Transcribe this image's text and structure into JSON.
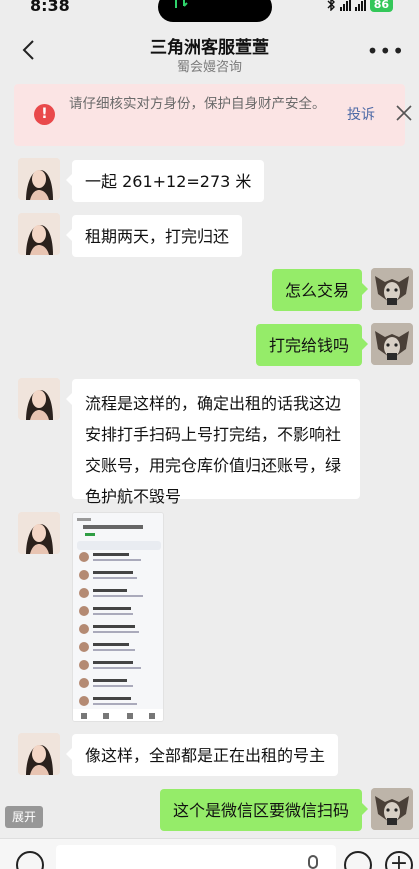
{
  "status_bar": {
    "time": "8:38",
    "battery": "86"
  },
  "nav": {
    "title": "三角洲客服萱萱",
    "subtitle": "蜀会嫚咨询"
  },
  "warning": {
    "text": "请仔细核实对方身份，保护自身财产安全。",
    "report_label": "投诉"
  },
  "messages": [
    {
      "side": "in",
      "text": "一起 261+12=273 米"
    },
    {
      "side": "in",
      "text": "租期两天，打完归还"
    },
    {
      "side": "out",
      "text": "怎么交易"
    },
    {
      "side": "out",
      "text": "打完给钱吗"
    },
    {
      "side": "in",
      "text": "流程是这样的，确定出租的话我这边安排打手扫码上号打完结，不影响社交账号，用完仓库价值归还账号，绿色护航不毁号"
    },
    {
      "side": "in",
      "type": "image"
    },
    {
      "side": "in",
      "text": "像这样，全部都是正在出租的号主"
    },
    {
      "side": "out",
      "text": "这个是微信区要微信扫码"
    }
  ],
  "expand_label": "展开",
  "colors": {
    "outgoing_bubble": "#95ec69",
    "incoming_bubble": "#ffffff",
    "background": "#ededed",
    "warning_bg": "#fbe4e4",
    "warning_icon": "#e9494b",
    "link": "#4e6aa6"
  }
}
